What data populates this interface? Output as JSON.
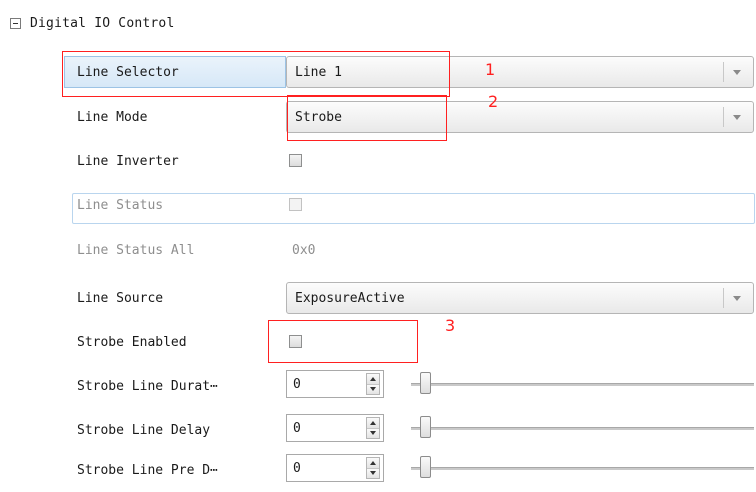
{
  "group": {
    "title": "Digital IO Control"
  },
  "rows": [
    {
      "label": "Line Selector",
      "type": "dropdown",
      "value": "Line 1"
    },
    {
      "label": "Line Mode",
      "type": "dropdown",
      "value": "Strobe"
    },
    {
      "label": "Line Inverter",
      "type": "checkbox",
      "checked": false
    },
    {
      "label": "Line Status",
      "type": "checkbox",
      "checked": false
    },
    {
      "label": "Line Status All",
      "type": "text",
      "value": "0x0"
    },
    {
      "label": "Line Source",
      "type": "dropdown",
      "value": "ExposureActive"
    },
    {
      "label": "Strobe Enabled",
      "type": "checkbox",
      "checked": false
    },
    {
      "label": "Strobe Line Durat⋯",
      "type": "spin",
      "value": "0"
    },
    {
      "label": "Strobe Line Delay",
      "type": "spin",
      "value": "0"
    },
    {
      "label": "Strobe Line Pre D⋯",
      "type": "spin",
      "value": "0"
    }
  ],
  "annotations": {
    "marker_1": "1",
    "marker_2": "2",
    "marker_3": "3",
    "color": "#ff2020"
  },
  "colors": {
    "selected_row": "#d6e8f7",
    "hover_border": "#b9d5ee",
    "disabled_text": "#8e8e8e"
  },
  "icons": {
    "collapse": "minus-square-icon",
    "dropdown": "chevron-down-icon",
    "spin_up": "triangle-up-icon",
    "spin_down": "triangle-down-icon"
  }
}
